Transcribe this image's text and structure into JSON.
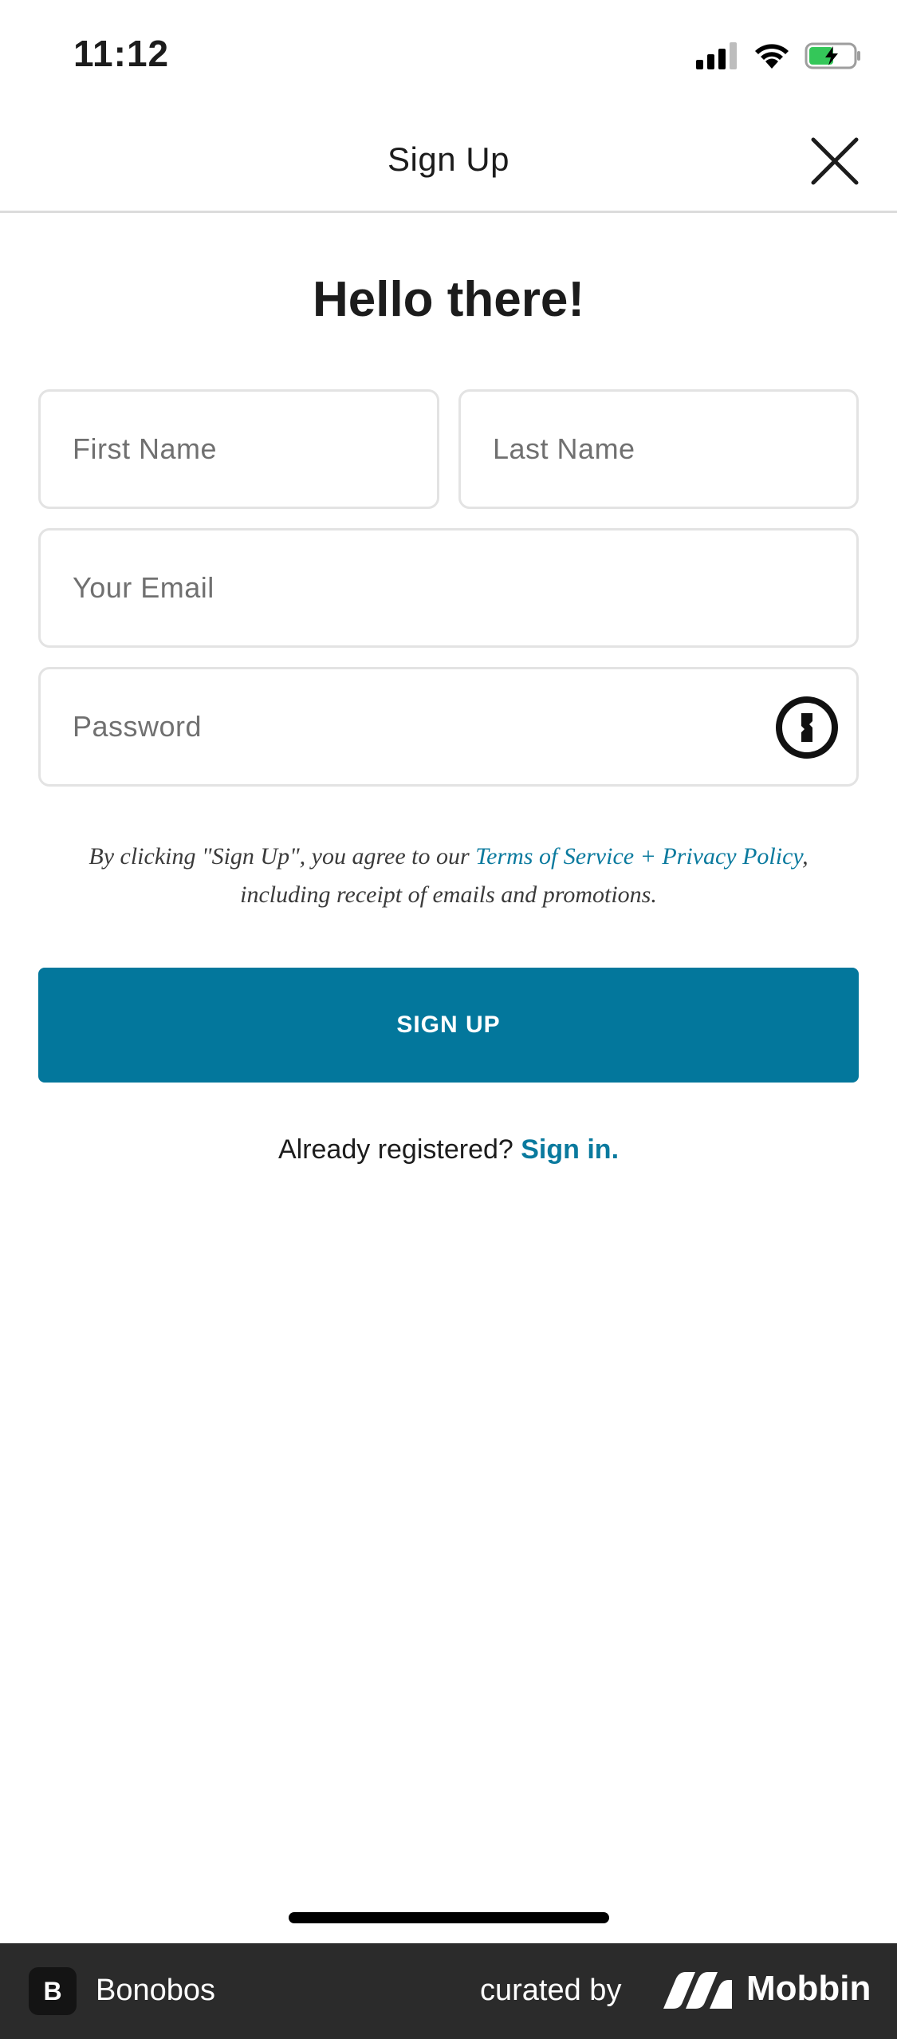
{
  "status_bar": {
    "time": "11:12"
  },
  "header": {
    "title": "Sign Up"
  },
  "form": {
    "heading": "Hello there!",
    "first_name_placeholder": "First Name",
    "last_name_placeholder": "Last Name",
    "email_placeholder": "Your Email",
    "password_placeholder": "Password",
    "legal_prefix": "By clicking \"Sign Up\", you agree to our ",
    "terms_link": "Terms of Service",
    "legal_joiner": " + ",
    "privacy_link": "Privacy Policy",
    "legal_suffix": ", including receipt of emails and promotions.",
    "submit_label": "SIGN UP",
    "signin_prompt": "Already registered? ",
    "signin_link": "Sign in."
  },
  "footer": {
    "app_badge": "B",
    "app_name": "Bonobos",
    "curated_by": "curated by",
    "brand": "Mobbin"
  },
  "colors": {
    "accent": "#03779c",
    "link": "#0a7a9e",
    "battery": "#34c759"
  }
}
